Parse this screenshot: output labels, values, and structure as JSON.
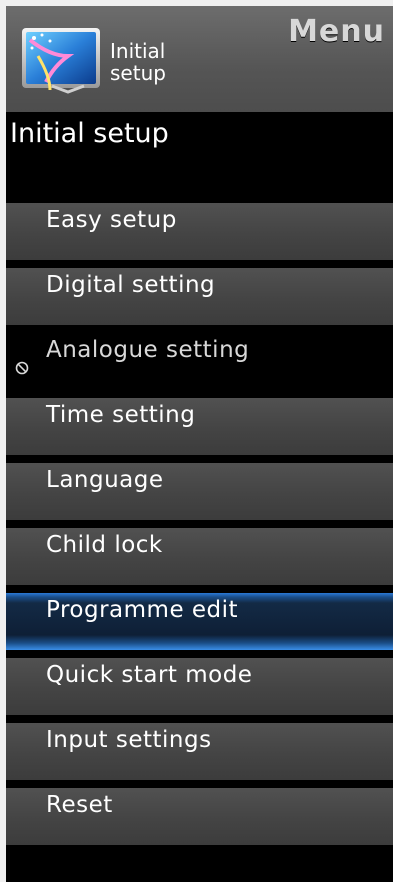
{
  "header": {
    "menu_label": "Menu",
    "icon_name": "initial-setup-icon",
    "subtitle_line1": "Initial",
    "subtitle_line2": "setup"
  },
  "section": {
    "title": "Initial setup"
  },
  "menu": {
    "items": [
      {
        "label": "Easy setup",
        "state": "normal"
      },
      {
        "label": "Digital setting",
        "state": "normal"
      },
      {
        "label": "Analogue setting",
        "state": "disabled",
        "icon": "no-entry-icon"
      },
      {
        "label": "Time setting",
        "state": "normal"
      },
      {
        "label": "Language",
        "state": "normal"
      },
      {
        "label": "Child lock",
        "state": "normal"
      },
      {
        "label": "Programme edit",
        "state": "selected"
      },
      {
        "label": "Quick start mode",
        "state": "normal"
      },
      {
        "label": "Input settings",
        "state": "normal"
      },
      {
        "label": "Reset",
        "state": "normal"
      }
    ]
  },
  "colors": {
    "selected_highlight": "#2a79d6",
    "item_background": "#4a4a4a",
    "panel_background": "#000000"
  }
}
